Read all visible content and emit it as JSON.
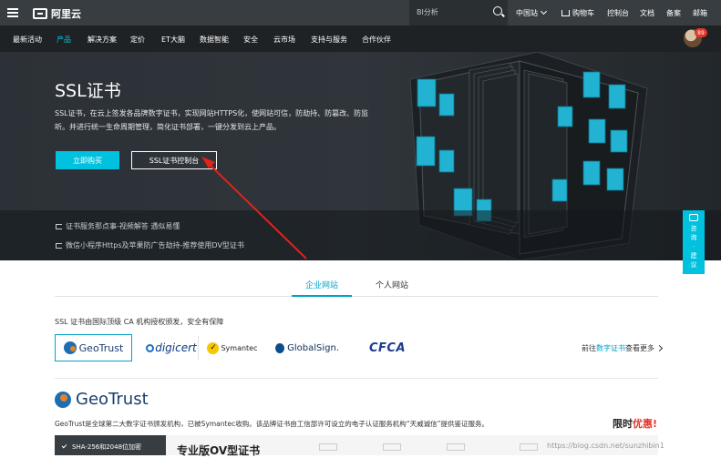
{
  "topbar": {
    "logo_text": "阿里云",
    "search_placeholder": "BI分析",
    "region": "中国站",
    "cart": "购物车",
    "console": "控制台",
    "docs": "文档",
    "filing": "备案",
    "mail": "邮箱"
  },
  "nav": {
    "items": [
      "最新活动",
      "产品",
      "解决方案",
      "定价",
      "ET大脑",
      "数据智能",
      "安全",
      "云市场",
      "支持与服务",
      "合作伙伴"
    ],
    "active_index": 1,
    "avatar_badge": "89"
  },
  "hero": {
    "title": "SSL证书",
    "description": "SSL证书，在云上签发各品牌数字证书，实现网站HTTPS化，使网站可信，防劫持、防篡改、防监听。并进行统一生命周期管理，简化证书部署，一键分发到云上产品。",
    "buy_button": "立即购买",
    "console_button": "SSL证书控制台",
    "news": [
      "证书服务那点事-视频解答 遇似易懂",
      "微信小程序Https及苹果防广告劫持-推荐使用DV型证书"
    ]
  },
  "feedback": {
    "chars": [
      "咨",
      "询",
      "·",
      "建",
      "议"
    ]
  },
  "tabs": {
    "enterprise": "企业网站",
    "personal": "个人网站"
  },
  "brands": {
    "subtitle": "SSL 证书由国际顶级 CA 机构授权颁发，安全有保障",
    "geotrust": "GeoTrust",
    "digicert": "digicert",
    "symantec": "Symantec",
    "globalsign": "GlobalSign.",
    "cfca": "CFCA",
    "more_prefix": "前往",
    "more_link": "数字证书",
    "more_suffix": "查看更多"
  },
  "geotrust_section": {
    "logo": "GeoTrust",
    "description": "GeoTrust是全球第二大数字证书颁发机构，已被Symantec收购。该品牌证书由工信部许可设立的电子认证服务机构“天威诚信”提供鉴证服务。",
    "limited_prefix": "限时",
    "limited_highlight": "优惠!",
    "plan_left": "SHA-256和2048位加密",
    "plan_title": "专业版OV型证书"
  },
  "watermark": "https://blog.csdn.net/sunzhibin1"
}
